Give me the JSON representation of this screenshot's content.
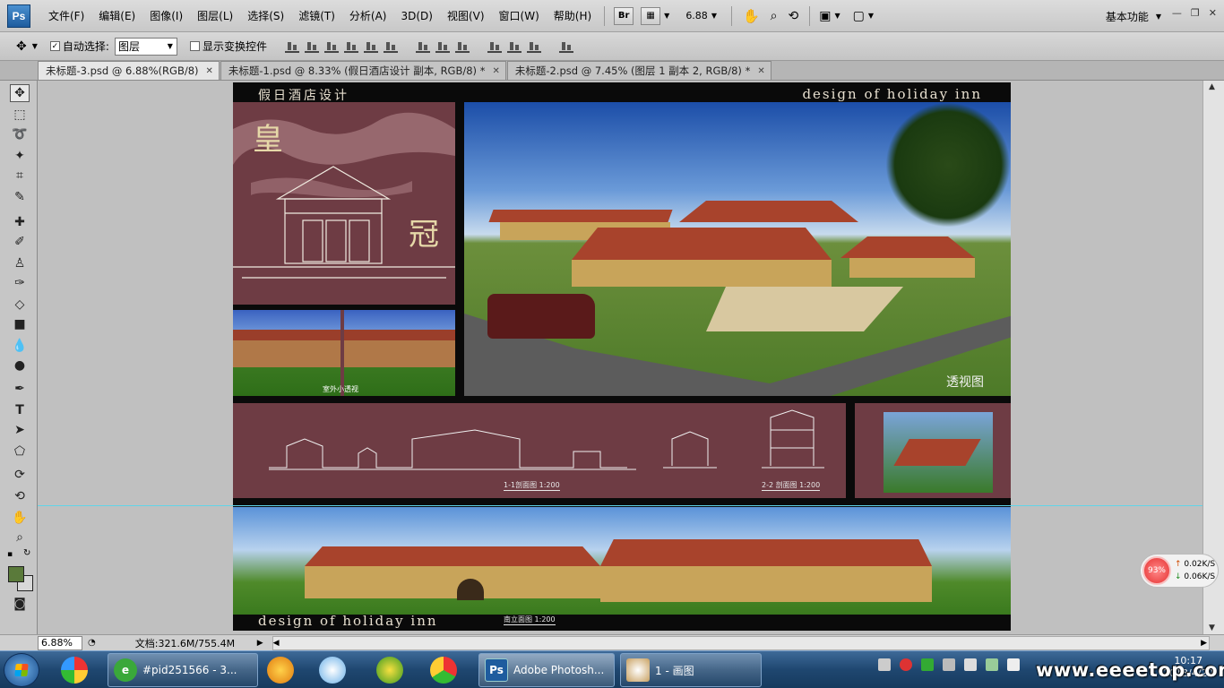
{
  "app": {
    "logo": "Ps",
    "menus": [
      "文件(F)",
      "编辑(E)",
      "图像(I)",
      "图层(L)",
      "选择(S)",
      "滤镜(T)",
      "分析(A)",
      "3D(D)",
      "视图(V)",
      "窗口(W)",
      "帮助(H)"
    ],
    "bridge_label": "Br",
    "zoom_level": "6.88",
    "workspace": "基本功能",
    "window_controls": [
      "—",
      "❐",
      "✕"
    ]
  },
  "options_bar": {
    "auto_select_label": "自动选择:",
    "auto_select_checked": true,
    "auto_select_value": "图层",
    "show_transform_label": "显示变换控件",
    "show_transform_checked": false
  },
  "tabs": [
    {
      "label": "未标题-3.psd @ 6.88%(RGB/8)",
      "active": true
    },
    {
      "label": "未标题-1.psd @ 8.33% (假日酒店设计 副本, RGB/8) *",
      "active": false
    },
    {
      "label": "未标题-2.psd @ 7.45% (图层 1 副本 2, RGB/8) *",
      "active": false
    }
  ],
  "document": {
    "header_cn": "假日酒店设计",
    "header_en": "design of holiday inn",
    "title_char_1": "皇",
    "title_char_2": "冠",
    "small_pic_label": "室外小透视",
    "perspective_label": "透视图",
    "section_label_1": "1-1剖面图 1:200",
    "section_label_2": "2-2 剖面图 1:200",
    "footer_en": "design of holiday inn",
    "elevation_label": "南立面图 1:200"
  },
  "status": {
    "zoom": "6.88%",
    "doc_info": "文档:321.6M/755.4M"
  },
  "network": {
    "percent": "93%",
    "up": "0.02K/S",
    "down": "0.06K/S"
  },
  "taskbar": {
    "buttons": [
      {
        "label": "#pid251566 - 3..."
      },
      {
        "label": "Adobe Photosh..."
      },
      {
        "label": "1 - 画图"
      }
    ],
    "clock_time": "10:17",
    "clock_date": "2013/4/29"
  },
  "watermark": "www.eeeetop.com",
  "colors": {
    "maroon_panel": "#6e3c44",
    "guide": "#5fd5e8",
    "foreground_swatch": "#5a7a3a",
    "taskbar": "#1f4770"
  }
}
